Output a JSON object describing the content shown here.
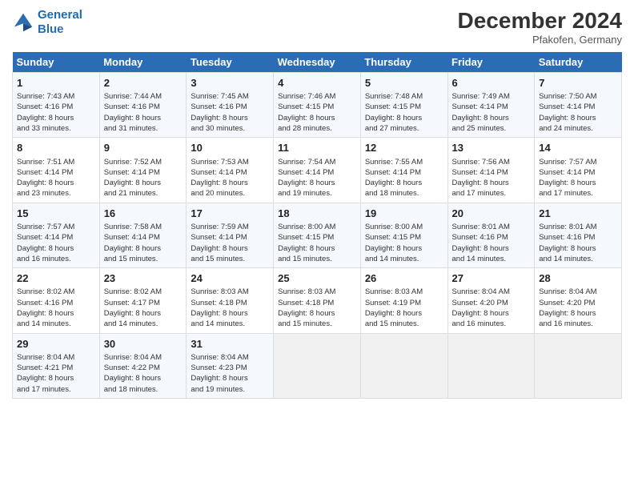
{
  "header": {
    "logo_line1": "General",
    "logo_line2": "Blue",
    "month": "December 2024",
    "location": "Pfakofen, Germany"
  },
  "days_of_week": [
    "Sunday",
    "Monday",
    "Tuesday",
    "Wednesday",
    "Thursday",
    "Friday",
    "Saturday"
  ],
  "weeks": [
    [
      {
        "day": "1",
        "info": "Sunrise: 7:43 AM\nSunset: 4:16 PM\nDaylight: 8 hours\nand 33 minutes."
      },
      {
        "day": "2",
        "info": "Sunrise: 7:44 AM\nSunset: 4:16 PM\nDaylight: 8 hours\nand 31 minutes."
      },
      {
        "day": "3",
        "info": "Sunrise: 7:45 AM\nSunset: 4:16 PM\nDaylight: 8 hours\nand 30 minutes."
      },
      {
        "day": "4",
        "info": "Sunrise: 7:46 AM\nSunset: 4:15 PM\nDaylight: 8 hours\nand 28 minutes."
      },
      {
        "day": "5",
        "info": "Sunrise: 7:48 AM\nSunset: 4:15 PM\nDaylight: 8 hours\nand 27 minutes."
      },
      {
        "day": "6",
        "info": "Sunrise: 7:49 AM\nSunset: 4:14 PM\nDaylight: 8 hours\nand 25 minutes."
      },
      {
        "day": "7",
        "info": "Sunrise: 7:50 AM\nSunset: 4:14 PM\nDaylight: 8 hours\nand 24 minutes."
      }
    ],
    [
      {
        "day": "8",
        "info": "Sunrise: 7:51 AM\nSunset: 4:14 PM\nDaylight: 8 hours\nand 23 minutes."
      },
      {
        "day": "9",
        "info": "Sunrise: 7:52 AM\nSunset: 4:14 PM\nDaylight: 8 hours\nand 21 minutes."
      },
      {
        "day": "10",
        "info": "Sunrise: 7:53 AM\nSunset: 4:14 PM\nDaylight: 8 hours\nand 20 minutes."
      },
      {
        "day": "11",
        "info": "Sunrise: 7:54 AM\nSunset: 4:14 PM\nDaylight: 8 hours\nand 19 minutes."
      },
      {
        "day": "12",
        "info": "Sunrise: 7:55 AM\nSunset: 4:14 PM\nDaylight: 8 hours\nand 18 minutes."
      },
      {
        "day": "13",
        "info": "Sunrise: 7:56 AM\nSunset: 4:14 PM\nDaylight: 8 hours\nand 17 minutes."
      },
      {
        "day": "14",
        "info": "Sunrise: 7:57 AM\nSunset: 4:14 PM\nDaylight: 8 hours\nand 17 minutes."
      }
    ],
    [
      {
        "day": "15",
        "info": "Sunrise: 7:57 AM\nSunset: 4:14 PM\nDaylight: 8 hours\nand 16 minutes."
      },
      {
        "day": "16",
        "info": "Sunrise: 7:58 AM\nSunset: 4:14 PM\nDaylight: 8 hours\nand 15 minutes."
      },
      {
        "day": "17",
        "info": "Sunrise: 7:59 AM\nSunset: 4:14 PM\nDaylight: 8 hours\nand 15 minutes."
      },
      {
        "day": "18",
        "info": "Sunrise: 8:00 AM\nSunset: 4:15 PM\nDaylight: 8 hours\nand 15 minutes."
      },
      {
        "day": "19",
        "info": "Sunrise: 8:00 AM\nSunset: 4:15 PM\nDaylight: 8 hours\nand 14 minutes."
      },
      {
        "day": "20",
        "info": "Sunrise: 8:01 AM\nSunset: 4:16 PM\nDaylight: 8 hours\nand 14 minutes."
      },
      {
        "day": "21",
        "info": "Sunrise: 8:01 AM\nSunset: 4:16 PM\nDaylight: 8 hours\nand 14 minutes."
      }
    ],
    [
      {
        "day": "22",
        "info": "Sunrise: 8:02 AM\nSunset: 4:16 PM\nDaylight: 8 hours\nand 14 minutes."
      },
      {
        "day": "23",
        "info": "Sunrise: 8:02 AM\nSunset: 4:17 PM\nDaylight: 8 hours\nand 14 minutes."
      },
      {
        "day": "24",
        "info": "Sunrise: 8:03 AM\nSunset: 4:18 PM\nDaylight: 8 hours\nand 14 minutes."
      },
      {
        "day": "25",
        "info": "Sunrise: 8:03 AM\nSunset: 4:18 PM\nDaylight: 8 hours\nand 15 minutes."
      },
      {
        "day": "26",
        "info": "Sunrise: 8:03 AM\nSunset: 4:19 PM\nDaylight: 8 hours\nand 15 minutes."
      },
      {
        "day": "27",
        "info": "Sunrise: 8:04 AM\nSunset: 4:20 PM\nDaylight: 8 hours\nand 16 minutes."
      },
      {
        "day": "28",
        "info": "Sunrise: 8:04 AM\nSunset: 4:20 PM\nDaylight: 8 hours\nand 16 minutes."
      }
    ],
    [
      {
        "day": "29",
        "info": "Sunrise: 8:04 AM\nSunset: 4:21 PM\nDaylight: 8 hours\nand 17 minutes."
      },
      {
        "day": "30",
        "info": "Sunrise: 8:04 AM\nSunset: 4:22 PM\nDaylight: 8 hours\nand 18 minutes."
      },
      {
        "day": "31",
        "info": "Sunrise: 8:04 AM\nSunset: 4:23 PM\nDaylight: 8 hours\nand 19 minutes."
      },
      null,
      null,
      null,
      null
    ]
  ]
}
